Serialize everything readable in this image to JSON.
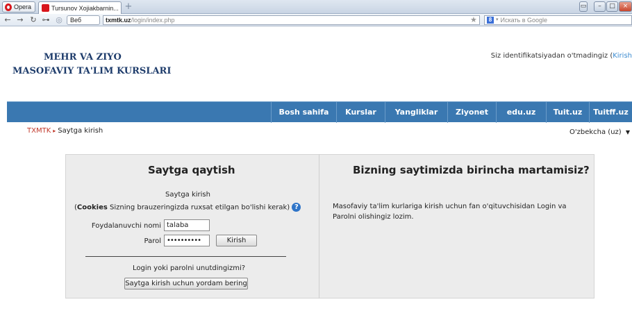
{
  "browser": {
    "opera_label": "Opera",
    "tab_title": "Tursunov Xojiakbarnin...",
    "tab_close": "×",
    "newtab": "+",
    "web_label": "Веб",
    "url_host": "txmtk.uz",
    "url_path": "/login/index.php",
    "search_placeholder": "Искать в Google",
    "search_engine_icon": "8"
  },
  "header": {
    "logo_line1": "MEHR VA ZIYO",
    "logo_line2": "MASOFAVIY TA'LIM KURSLARI",
    "login_info": "Siz identifikatsiyadan o'tmadingiz (",
    "login_link": "Kirish"
  },
  "menu": [
    "Bosh sahifa",
    "Kurslar",
    "Yangliklar",
    "Ziyonet",
    "edu.uz",
    "Tuit.uz",
    "Tuitff.uz"
  ],
  "breadcrumb": {
    "home": "TXMTK",
    "separator": "▸",
    "current": "Saytga kirish"
  },
  "language": {
    "selected": "O'zbekcha (uz)"
  },
  "login": {
    "heading": "Saytga qaytish",
    "subheading": "Saytga kirish",
    "cookies_bold": "Cookies",
    "cookies_text": " Sizning brauzeringizda ruxsat etilgan bo'lishi kerak)",
    "cookies_open": "(",
    "username_label": "Foydalanuvchi nomi",
    "username_value": "talaba",
    "password_label": "Parol",
    "password_value": "••••••••••",
    "submit_label": "Kirish",
    "forgot_text": "Login yoki parolni unutdingizmi?",
    "help_button": "Saytga kirish uchun yordam bering"
  },
  "signup": {
    "heading": "Bizning saytimizda birincha martamisiz?",
    "text": "Masofaviy ta'lim kurlariga kirish uchun fan o'qituvchisidan Login va Parolni olishingiz lozim."
  }
}
